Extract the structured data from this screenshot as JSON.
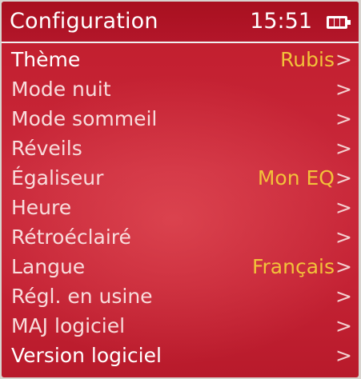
{
  "header": {
    "title": "Configuration",
    "time": "15:51",
    "battery_icon": "battery-icon"
  },
  "menu": {
    "chevron_glyph": ">",
    "items": [
      {
        "label": "Thème",
        "value": "Rubis"
      },
      {
        "label": "Mode nuit",
        "value": ""
      },
      {
        "label": "Mode sommeil",
        "value": ""
      },
      {
        "label": "Réveils",
        "value": ""
      },
      {
        "label": "Égaliseur",
        "value": "Mon EQ"
      },
      {
        "label": "Heure",
        "value": ""
      },
      {
        "label": "Rétroéclairé",
        "value": ""
      },
      {
        "label": "Langue",
        "value": "Français"
      },
      {
        "label": "Régl. en usine",
        "value": ""
      },
      {
        "label": "MAJ logiciel",
        "value": ""
      },
      {
        "label": "Version logiciel",
        "value": ""
      }
    ]
  },
  "colors": {
    "background": "#c42234",
    "header_background": "#a8101f",
    "value_text": "#f2c23a",
    "label_text": "#f8dcdc"
  }
}
